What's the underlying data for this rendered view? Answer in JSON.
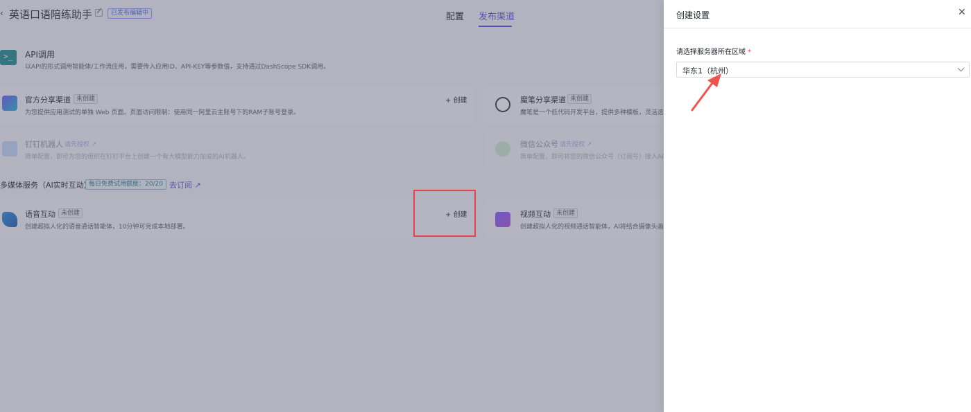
{
  "header": {
    "back_glyph": "‹",
    "app_title": "英语口语陪练助手",
    "status_badge": "已发布编辑中",
    "tabs": [
      "配置",
      "发布渠道"
    ]
  },
  "api_channel": {
    "title": "API调用",
    "description": "以API的形式调用智能体/工作流应用，需要传入应用ID、API-KEY等参数值，支持通过DashScope SDK调用。"
  },
  "channels": {
    "official_share": {
      "title": "官方分享渠道",
      "badge": "未创建",
      "description": "为您提供应用测试的单独 Web 页面。页面访问限制：使用同一阿里云主账号下的RAM子账号登录。",
      "action": "+ 创建"
    },
    "modelscope_share": {
      "title": "魔笔分享渠道",
      "badge": "未创建",
      "description": "魔笔是一个低代码开发平台，提供多种模板，灵活选用"
    },
    "dingtalk": {
      "title": "钉钉机器人",
      "auth": "请先授权 ↗",
      "description": "简单配置，即可为您的组织在钉钉平台上创建一个有大模型能力加成的AI机器人。"
    },
    "wechat": {
      "title": "微信公众号",
      "auth": "请先授权 ↗",
      "description": "简单配置，即可将您的微信公众号（订阅号）接入AI模"
    }
  },
  "multimedia": {
    "section_title": "多媒体服务（AI实时互动）",
    "quota_badge": "每日免费试用额度：20/20",
    "subscribe_link": "去订阅 ↗",
    "voice": {
      "title": "语音互动",
      "badge": "未创建",
      "description": "创建超拟人化的语音通话智能体，10分钟可完成本地部署。",
      "action": "+ 创建"
    },
    "video": {
      "title": "视频互动",
      "badge": "未创建",
      "description": "创建超拟人化的视频通话智能体，AI将结合摄像头画面"
    }
  },
  "drawer": {
    "title": "创建设置",
    "close_glyph": "✕",
    "region_label": "请选择服务器所在区域",
    "required_mark": "*",
    "region_value": "华东1（杭州）"
  },
  "colors": {
    "accent": "#5e4fd6",
    "highlight_box": "#e8434c",
    "annotation_arrow": "#f0544f"
  }
}
